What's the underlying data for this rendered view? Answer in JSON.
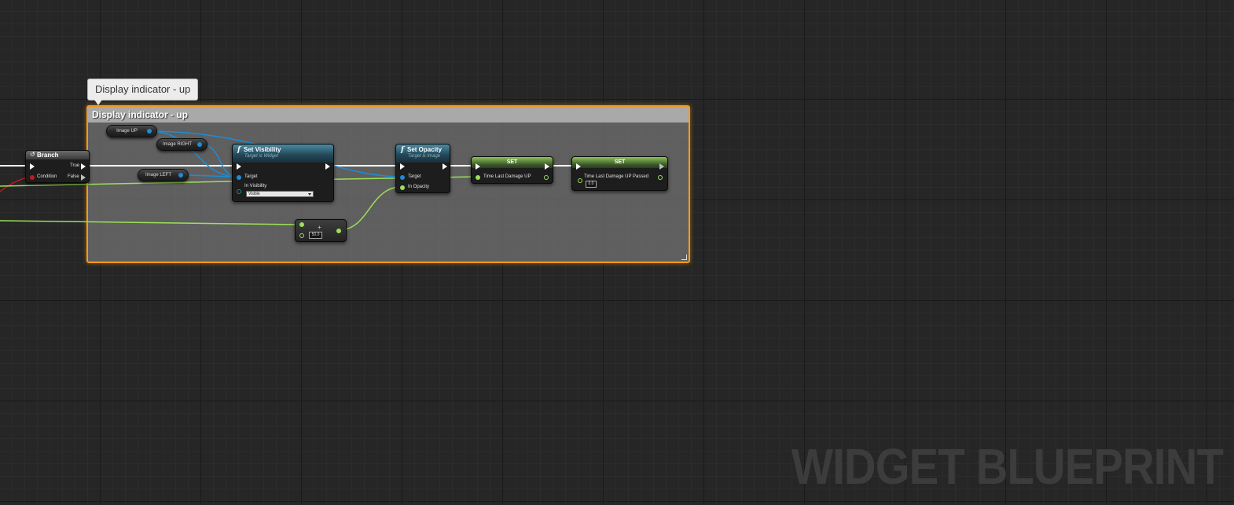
{
  "canvas": {
    "grid_color": "#1a1a1a",
    "background": "#262626"
  },
  "tooltip": {
    "text": "Display indicator - up"
  },
  "comment_box": {
    "title": "Display indicator - up",
    "border_color": "#f29a1b"
  },
  "branch_node": {
    "title": "Branch",
    "icon": "branch-icon",
    "pins": {
      "true_label": "True",
      "false_label": "False",
      "condition_label": "Condition"
    }
  },
  "variables": {
    "image_up": "Image UP",
    "image_right": "Image RIGHT",
    "image_left": "Image LEFT"
  },
  "set_visibility": {
    "title": "Set Visibility",
    "subtitle": "Target is Widget",
    "target_label": "Target",
    "in_visibility_label": "In Visibility",
    "in_visibility_value": "Visible"
  },
  "set_opacity": {
    "title": "Set Opacity",
    "subtitle": "Target is Image",
    "target_label": "Target",
    "in_opacity_label": "In Opacity"
  },
  "set_node_1": {
    "title": "SET",
    "var_label": "Time Last Damage UP"
  },
  "set_node_2": {
    "title": "SET",
    "var_label": "Time Last Damage UP Passed",
    "value": "0.0"
  },
  "add_node": {
    "value": "50.0",
    "op_icon": "plus-icon"
  },
  "wire_colors": {
    "exec": "#ffffff",
    "object": "#1d8cd6",
    "float": "#9be058",
    "bool": "#c21a1a"
  },
  "watermark": {
    "text": "WIDGET BLUEPRINT"
  }
}
